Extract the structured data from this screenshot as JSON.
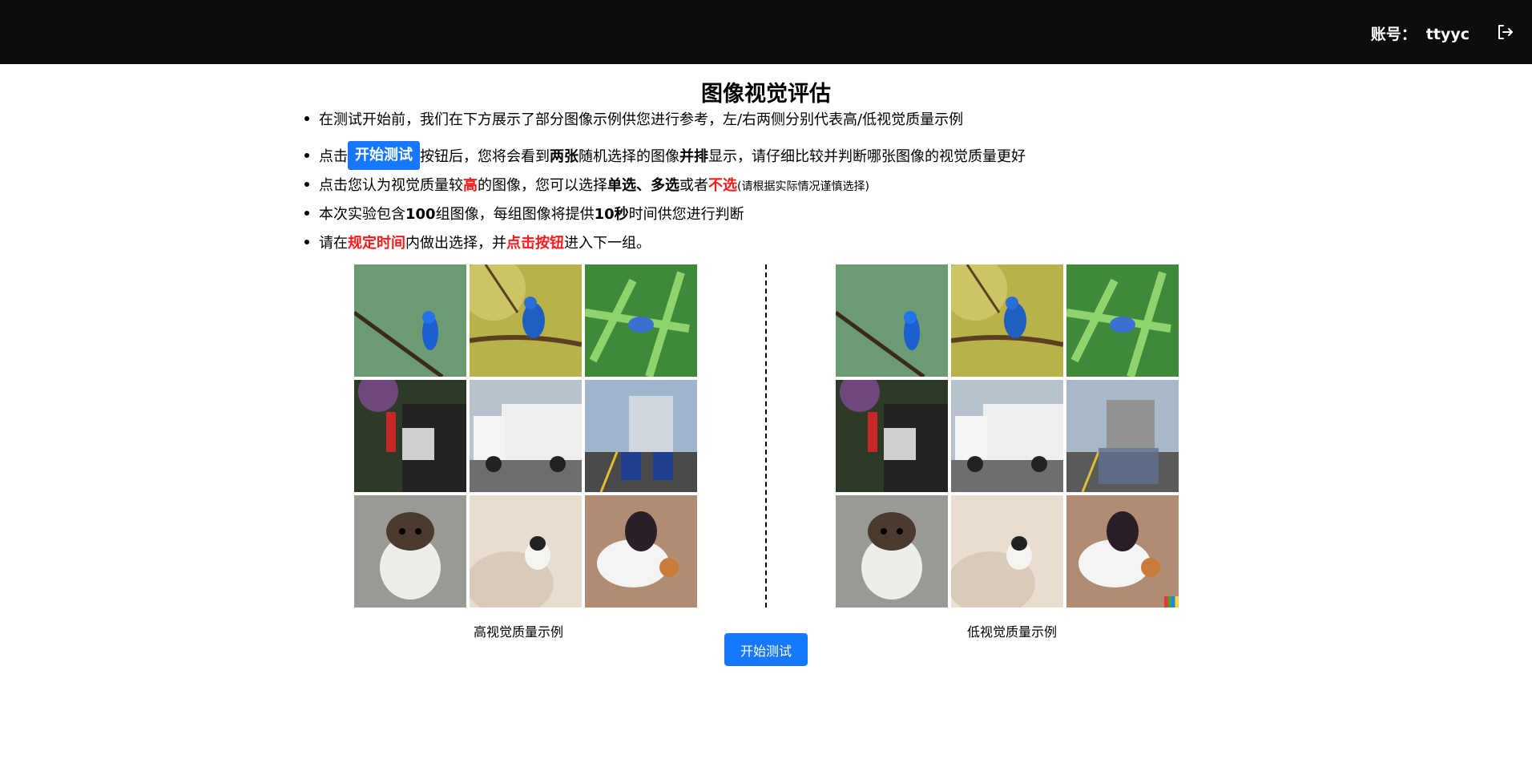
{
  "header": {
    "account_label": "账号：",
    "username": "ttyyc",
    "logout_icon": "logout-icon"
  },
  "page_title": "图像视觉评估",
  "rules": {
    "r1": "在测试开始前，我们在下方展示了部分图像示例供您进行参考，左/右两侧分别代表高/低视觉质量示例",
    "r2": {
      "a": "点击",
      "btn": "开始测试",
      "b": "按钮后，您将会看到",
      "c": "两张",
      "d": "随机选择的图像",
      "e": "并排",
      "f": "显示，请仔细比较并判断哪张图像的视觉质量更好"
    },
    "r3": {
      "a": "点击您认为视觉质量较",
      "b": "高",
      "c": "的图像，您可以选择",
      "d": "单选",
      "e": "、",
      "f": "多选",
      "g": "或者",
      "h": "不选",
      "i": "(请根据实际情况谨慎选择)"
    },
    "r4": {
      "a": "本次实验包含",
      "b": "100",
      "c": "组图像，每组图像将提供",
      "d": "10秒",
      "e": "时间供您进行判断"
    },
    "r5": {
      "a": "请在",
      "b": "规定时间",
      "c": "内做出选择，并",
      "d": "点击按钮",
      "e": "进入下一组。"
    }
  },
  "examples": {
    "high_caption": "高视觉质量示例",
    "low_caption": "低视觉质量示例"
  },
  "start_button": "开始测试",
  "colors": {
    "accent": "#1677ff",
    "header_bg": "#0d0d0d",
    "emphasis_red": "#ff1a1a"
  }
}
